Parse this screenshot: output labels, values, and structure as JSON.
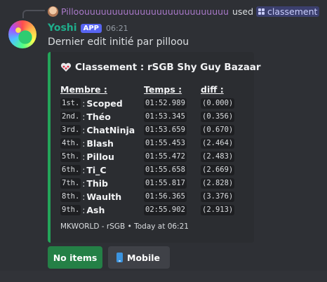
{
  "reply": {
    "username": "Pilloouuuuuuuuuuuuuuuuuuuuuuuuuu",
    "action": "used",
    "command": "classement"
  },
  "message": {
    "username": "Yoshi",
    "badge": "APP",
    "time": "06:21",
    "content": "Dernier edit initié par pilloou"
  },
  "embed": {
    "accent_color": "#23a559",
    "title": "Classement : rSGB Shy Guy Bazaar",
    "columns": {
      "member": "Membre :",
      "time": "Temps :",
      "diff": "diff :"
    },
    "rows": [
      {
        "rank": "1st.",
        "name": "Scoped",
        "time": "01:52.989",
        "diff": "(0.000)"
      },
      {
        "rank": "2nd.",
        "name": "Théo",
        "time": "01:53.345",
        "diff": "(0.356)"
      },
      {
        "rank": "3rd.",
        "name": "ChatNinja",
        "time": "01:53.659",
        "diff": "(0.670)"
      },
      {
        "rank": "4th.",
        "name": "Blash",
        "time": "01:55.453",
        "diff": "(2.464)"
      },
      {
        "rank": "5th.",
        "name": "Pillou",
        "time": "01:55.472",
        "diff": "(2.483)"
      },
      {
        "rank": "6th.",
        "name": "Ti_C",
        "time": "01:55.658",
        "diff": "(2.669)"
      },
      {
        "rank": "7th.",
        "name": "Thib",
        "time": "01:55.817",
        "diff": "(2.828)"
      },
      {
        "rank": "8th.",
        "name": "Waulth",
        "time": "01:56.365",
        "diff": "(3.376)"
      },
      {
        "rank": "9th.",
        "name": "Ash",
        "time": "02:55.902",
        "diff": "(2.913)"
      }
    ],
    "separator": ":",
    "footer": "MKWORLD - rSGB • Today at 06:21"
  },
  "buttons": {
    "no_items": "No items",
    "mobile": "Mobile"
  }
}
